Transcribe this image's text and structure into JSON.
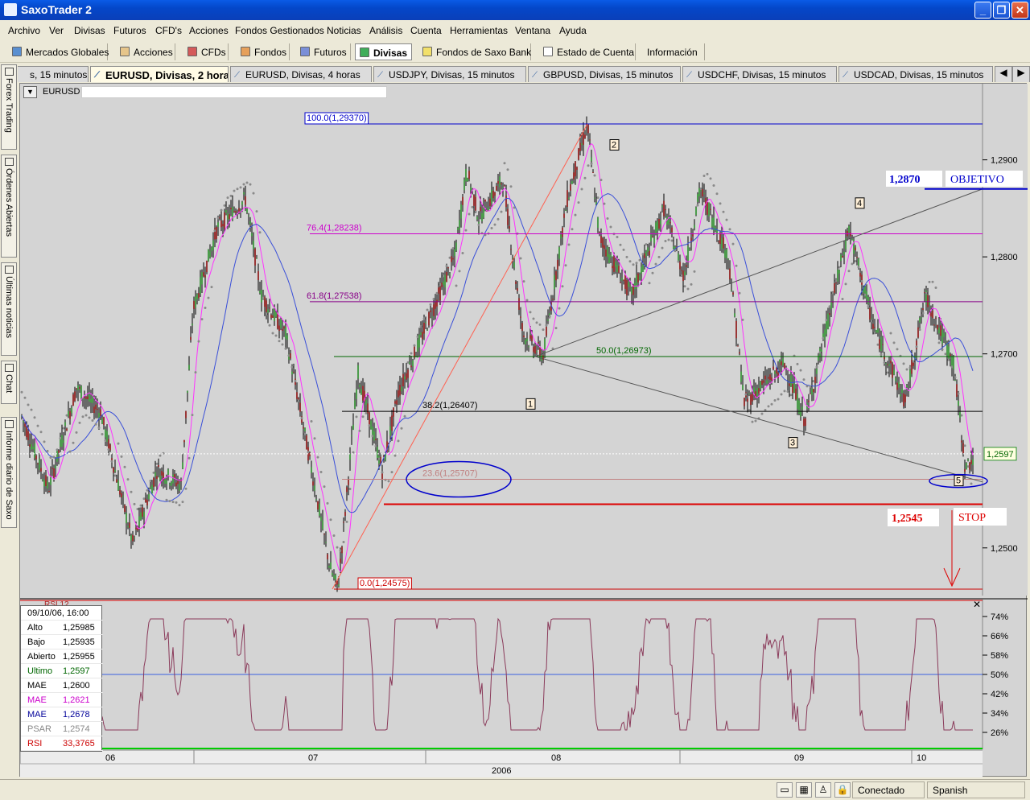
{
  "window": {
    "title": "SaxoTrader 2"
  },
  "menu": [
    "Archivo",
    "Ver",
    "Divisas",
    "Futuros",
    "CFD's",
    "Acciones",
    "Fondos Gestionados",
    "Noticias",
    "Análisis",
    "Cuenta",
    "Herramientas",
    "Ventana",
    "Ayuda"
  ],
  "nav": [
    "Mercados Globales",
    "Acciones",
    "CFDs",
    "Fondos",
    "Futuros",
    "Divisas",
    "Fondos de Saxo Bank",
    "Estado de Cuenta",
    "Información"
  ],
  "tabs": [
    "s, 15 minutos",
    "EURUSD, Divisas, 2 horas",
    "EURUSD, Divisas, 4 horas",
    "USDJPY, Divisas, 15 minutos",
    "GBPUSD, Divisas, 15 minutos",
    "USDCHF, Divisas, 15 minutos",
    "USDCAD, Divisas, 15 minutos"
  ],
  "side_tabs": [
    "Forex Trading",
    "Órdenes Abiertas",
    "Últimas noticias",
    "Chat",
    "Informe diario de Saxo"
  ],
  "chart": {
    "symbol": "EURUSD",
    "price_ticks": [
      "1,2900",
      "1,2800",
      "1,2700",
      "1,2500"
    ],
    "current_price": "1,2597",
    "fib_levels": [
      {
        "label": "100.0(1,29370)",
        "value": 1.2937,
        "color": "#0000cc"
      },
      {
        "label": "76.4(1,28238)",
        "value": 1.28238,
        "color": "#cc00cc"
      },
      {
        "label": "61.8(1,27538)",
        "value": 1.27538,
        "color": "#880088"
      },
      {
        "label": "50.0(1,26973)",
        "value": 1.26973,
        "color": "#006600"
      },
      {
        "label": "38.2(1,26407)",
        "value": 1.26407,
        "color": "#000000"
      },
      {
        "label": "23.6(1,25707)",
        "value": 1.25707,
        "color": "#c08080"
      },
      {
        "label": "0.0(1,24575)",
        "value": 1.24575,
        "color": "#cc0000"
      }
    ],
    "waves": [
      "1",
      "2",
      "3",
      "4",
      "5"
    ],
    "annotations": {
      "target_value": "1,2870",
      "target_label": "OBJETIVO",
      "stop_value": "1,2545",
      "stop_label": "STOP"
    },
    "rsi_label": "RSI 12",
    "rsi_ticks": [
      "74%",
      "66%",
      "58%",
      "50%",
      "42%",
      "34%",
      "26%"
    ],
    "x_months": [
      "06",
      "07",
      "08",
      "09",
      "10"
    ],
    "x_year": "2006"
  },
  "infobox": {
    "date": "09/10/06, 16:00",
    "rows": [
      {
        "label": "Alto",
        "value": "1,25985",
        "color": "#000000"
      },
      {
        "label": "Bajo",
        "value": "1,25935",
        "color": "#000000"
      },
      {
        "label": "Abierto",
        "value": "1,25955",
        "color": "#000000"
      },
      {
        "label": "Ultimo",
        "value": "1,2597",
        "color": "#006600"
      },
      {
        "label": "MAE",
        "value": "1,2600",
        "color": "#000000"
      },
      {
        "label": "MAE",
        "value": "1,2621",
        "color": "#cc00cc"
      },
      {
        "label": "MAE",
        "value": "1,2678",
        "color": "#000099"
      },
      {
        "label": "PSAR",
        "value": "1,2574",
        "color": "#888888"
      },
      {
        "label": "RSI",
        "value": "33,3765",
        "color": "#cc0000"
      }
    ]
  },
  "status": {
    "connection": "Conectado",
    "language": "Spanish"
  },
  "colors": {
    "titlebar": "#0a5be6",
    "chart_bg": "#d4d4d4",
    "fib_red": "#cc0000"
  }
}
